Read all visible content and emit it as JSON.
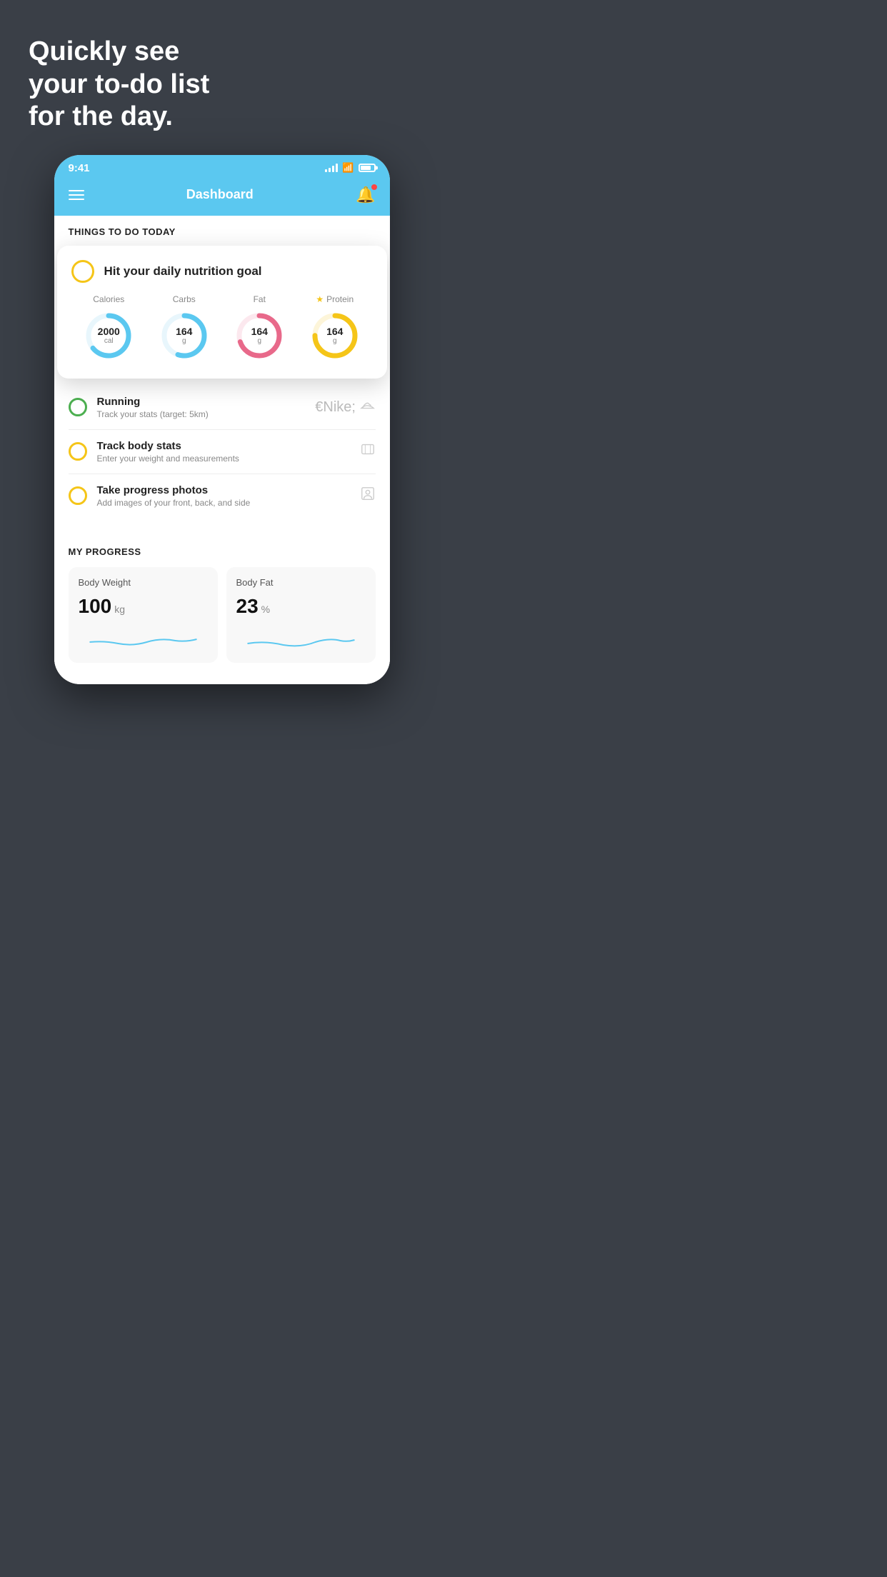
{
  "background_color": "#3a3f47",
  "hero": {
    "title": "Quickly see\nyour to-do list\nfor the day."
  },
  "status_bar": {
    "time": "9:41",
    "signal_bars": 4,
    "has_wifi": true,
    "has_battery": true
  },
  "header": {
    "title": "Dashboard",
    "has_notification": true
  },
  "things_to_do": {
    "section_title": "THINGS TO DO TODAY",
    "floating_card": {
      "goal_text": "Hit your daily nutrition goal",
      "items": [
        {
          "label": "Calories",
          "value": "2000",
          "unit": "cal",
          "color": "#5bc8f0",
          "progress": 0.65,
          "has_star": false
        },
        {
          "label": "Carbs",
          "value": "164",
          "unit": "g",
          "color": "#5bc8f0",
          "progress": 0.55,
          "has_star": false
        },
        {
          "label": "Fat",
          "value": "164",
          "unit": "g",
          "color": "#e8698a",
          "progress": 0.7,
          "has_star": false
        },
        {
          "label": "Protein",
          "value": "164",
          "unit": "g",
          "color": "#f5c518",
          "progress": 0.75,
          "has_star": true
        }
      ]
    },
    "todo_items": [
      {
        "title": "Running",
        "subtitle": "Track your stats (target: 5km)",
        "circle_color": "green",
        "icon": "shoe"
      },
      {
        "title": "Track body stats",
        "subtitle": "Enter your weight and measurements",
        "circle_color": "yellow",
        "icon": "scale"
      },
      {
        "title": "Take progress photos",
        "subtitle": "Add images of your front, back, and side",
        "circle_color": "yellow",
        "icon": "person"
      }
    ]
  },
  "my_progress": {
    "section_title": "MY PROGRESS",
    "cards": [
      {
        "title": "Body Weight",
        "value": "100",
        "unit": "kg"
      },
      {
        "title": "Body Fat",
        "value": "23",
        "unit": "%"
      }
    ]
  }
}
